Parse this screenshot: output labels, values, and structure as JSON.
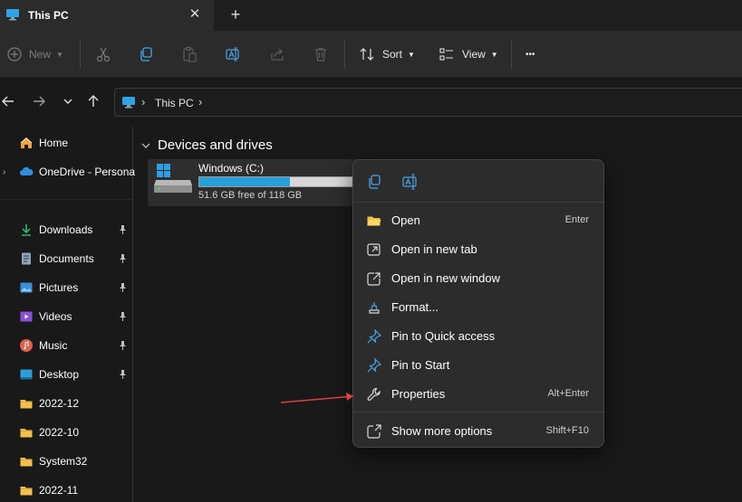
{
  "window": {
    "tab_title": "This PC",
    "close_glyph": "✕",
    "new_tab_glyph": "+"
  },
  "toolbar": {
    "new_label": "New",
    "sort_label": "Sort",
    "view_label": "View",
    "more_glyph": "•••",
    "icons": [
      "cut-icon",
      "copy-icon",
      "paste-icon",
      "rename-icon",
      "share-icon",
      "delete-icon"
    ]
  },
  "address": {
    "location": "This PC"
  },
  "sidebar": {
    "items": [
      {
        "label": "Home",
        "icon": "home-icon",
        "pinned": false
      },
      {
        "label": "OneDrive - Persona",
        "icon": "cloud-icon",
        "pinned": false
      },
      {
        "label": "Downloads",
        "icon": "download-icon",
        "pinned": true
      },
      {
        "label": "Documents",
        "icon": "document-icon",
        "pinned": true
      },
      {
        "label": "Pictures",
        "icon": "pictures-icon",
        "pinned": true
      },
      {
        "label": "Videos",
        "icon": "video-icon",
        "pinned": true
      },
      {
        "label": "Music",
        "icon": "music-icon",
        "pinned": true
      },
      {
        "label": "Desktop",
        "icon": "desktop-icon",
        "pinned": true
      },
      {
        "label": "2022-12",
        "icon": "folder-icon",
        "pinned": false
      },
      {
        "label": "2022-10",
        "icon": "folder-icon",
        "pinned": false
      },
      {
        "label": "System32",
        "icon": "folder-icon",
        "pinned": false
      },
      {
        "label": "2022-11",
        "icon": "folder-icon",
        "pinned": false
      }
    ]
  },
  "main": {
    "group_title": "Devices and drives",
    "drive": {
      "name": "Windows (C:)",
      "free_text": "51.6 GB free of 118 GB",
      "used_fraction": 0.563
    }
  },
  "context_menu": {
    "items": [
      {
        "label": "Open",
        "shortcut": "Enter",
        "icon": "folder-open-icon"
      },
      {
        "label": "Open in new tab",
        "shortcut": "",
        "icon": "open-new-tab-icon"
      },
      {
        "label": "Open in new window",
        "shortcut": "",
        "icon": "open-new-window-icon"
      },
      {
        "label": "Format...",
        "shortcut": "",
        "icon": "format-icon"
      },
      {
        "label": "Pin to Quick access",
        "shortcut": "",
        "icon": "pin-icon"
      },
      {
        "label": "Pin to Start",
        "shortcut": "",
        "icon": "pin-icon"
      },
      {
        "label": "Properties",
        "shortcut": "Alt+Enter",
        "icon": "wrench-icon"
      },
      {
        "label": "Show more options",
        "shortcut": "Shift+F10",
        "icon": "more-options-icon"
      }
    ]
  },
  "colors": {
    "accent": "#26a0da",
    "folder": "#f3c04c",
    "annotation_arrow": "#e0403a"
  }
}
